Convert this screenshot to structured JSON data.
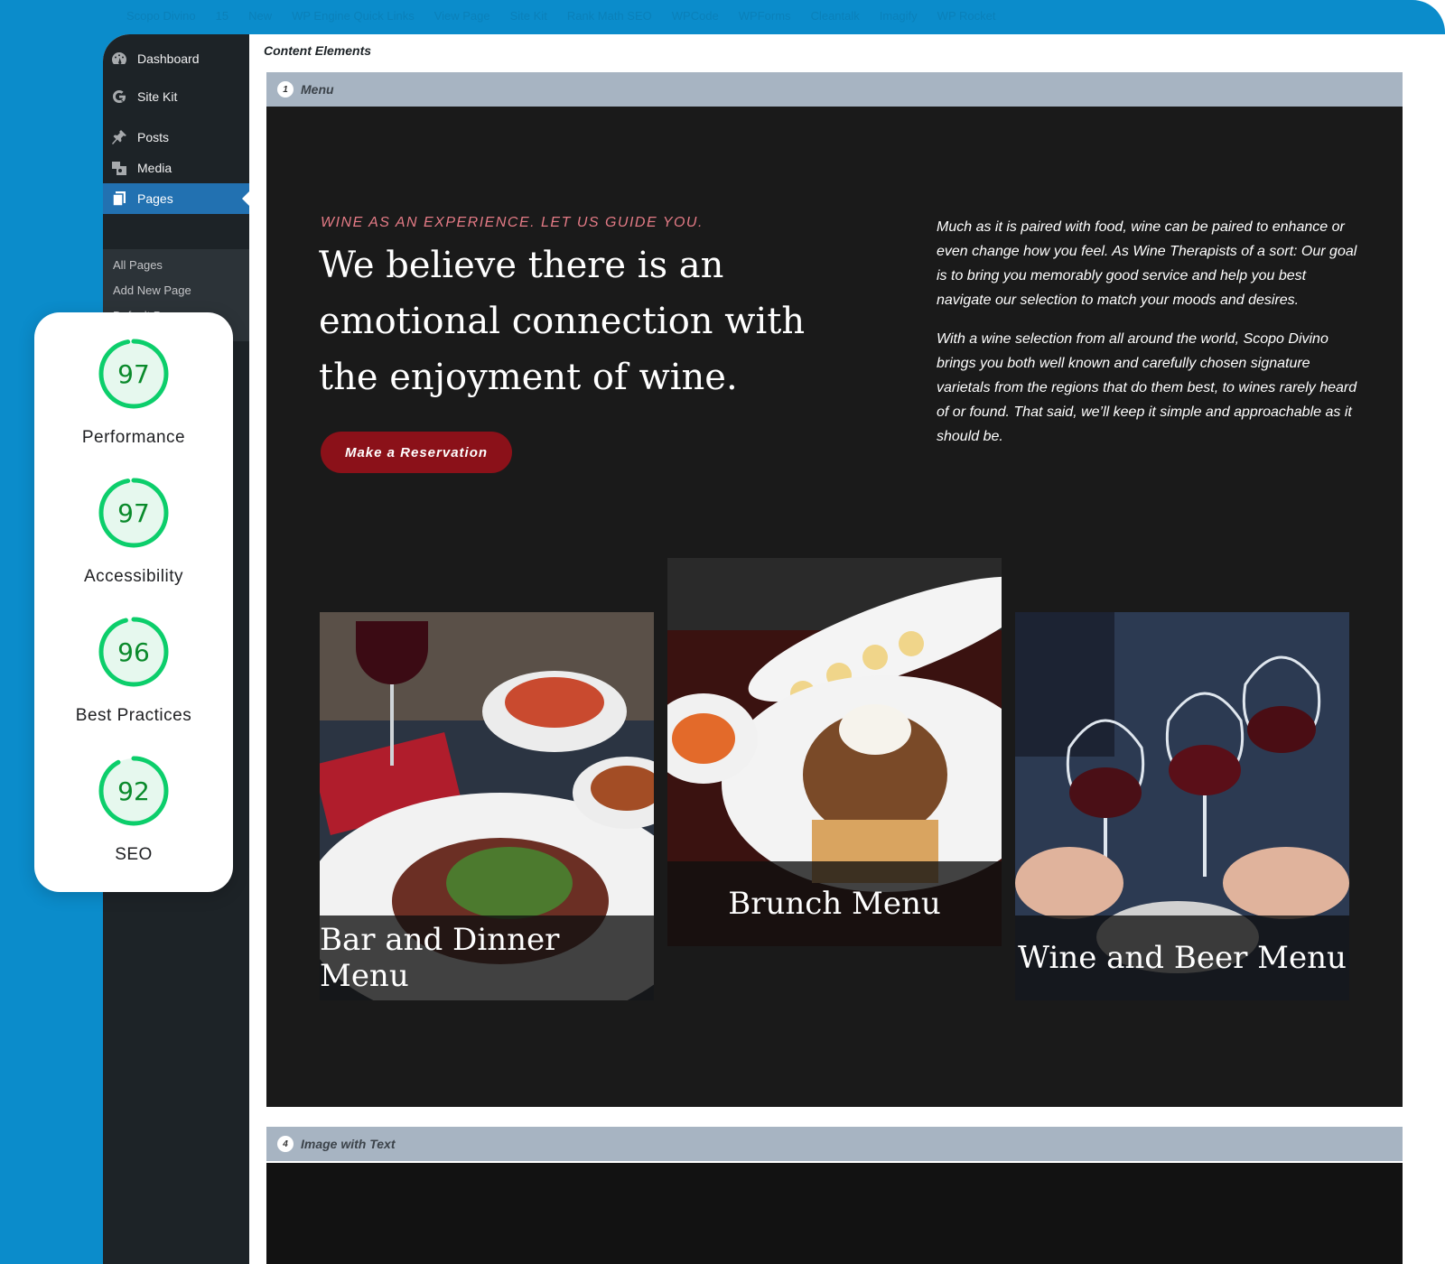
{
  "topbar": [
    "Scopo Divino",
    "15",
    "New",
    "WP Engine Quick Links",
    "View Page",
    "Site Kit",
    "Rank Math SEO",
    "WPCode",
    "WPForms",
    "Cleantalk",
    "Imagify",
    "WP Rocket"
  ],
  "sidebar": {
    "items": [
      {
        "label": "Dashboard",
        "icon": "dashboard-icon"
      },
      {
        "label": "Site Kit",
        "icon": "google-g-icon"
      },
      {
        "label": "Posts",
        "icon": "pin-icon"
      },
      {
        "label": "Media",
        "icon": "media-icon"
      },
      {
        "label": "Pages",
        "icon": "pages-icon",
        "active": true
      }
    ],
    "submenu": [
      "All Pages",
      "Add New Page",
      "Default Pages"
    ]
  },
  "editor": {
    "title": "Content Elements",
    "sections": [
      {
        "number": "1",
        "label": "Menu"
      },
      {
        "number": "4",
        "label": "Image with Text"
      }
    ]
  },
  "hero": {
    "eyebrow": "WINE AS AN EXPERIENCE. LET US GUIDE YOU.",
    "headline": "We believe there is an emotional connection with the enjoyment of wine.",
    "button": "Make a Reservation",
    "paragraph1": "Much as it is paired with food, wine can be paired to enhance or even change how you feel. As Wine Therapists of a sort: Our goal is to bring you memorably good service and help you best navigate our selection to match your moods and desires.",
    "paragraph2": "With a wine selection from all around the world, Scopo Divino brings you both well known and carefully chosen signature varietals from the regions that do them best, to wines rarely heard of or found. That said, we’ll keep it simple and approachable as it should be."
  },
  "menus": [
    {
      "caption": "Bar and Dinner Menu"
    },
    {
      "caption": "Brunch Menu"
    },
    {
      "caption": "Wine and Beer Menu"
    }
  ],
  "scores": [
    {
      "value": 97,
      "label": "Performance"
    },
    {
      "value": 97,
      "label": "Accessibility"
    },
    {
      "value": 96,
      "label": "Best Practices"
    },
    {
      "value": 92,
      "label": "SEO"
    }
  ],
  "colors": {
    "frame": "#0b8ccb",
    "accent": "#2271b1",
    "button": "#8b1119",
    "eyebrow": "#e57b86",
    "score": "#0cce6b"
  }
}
